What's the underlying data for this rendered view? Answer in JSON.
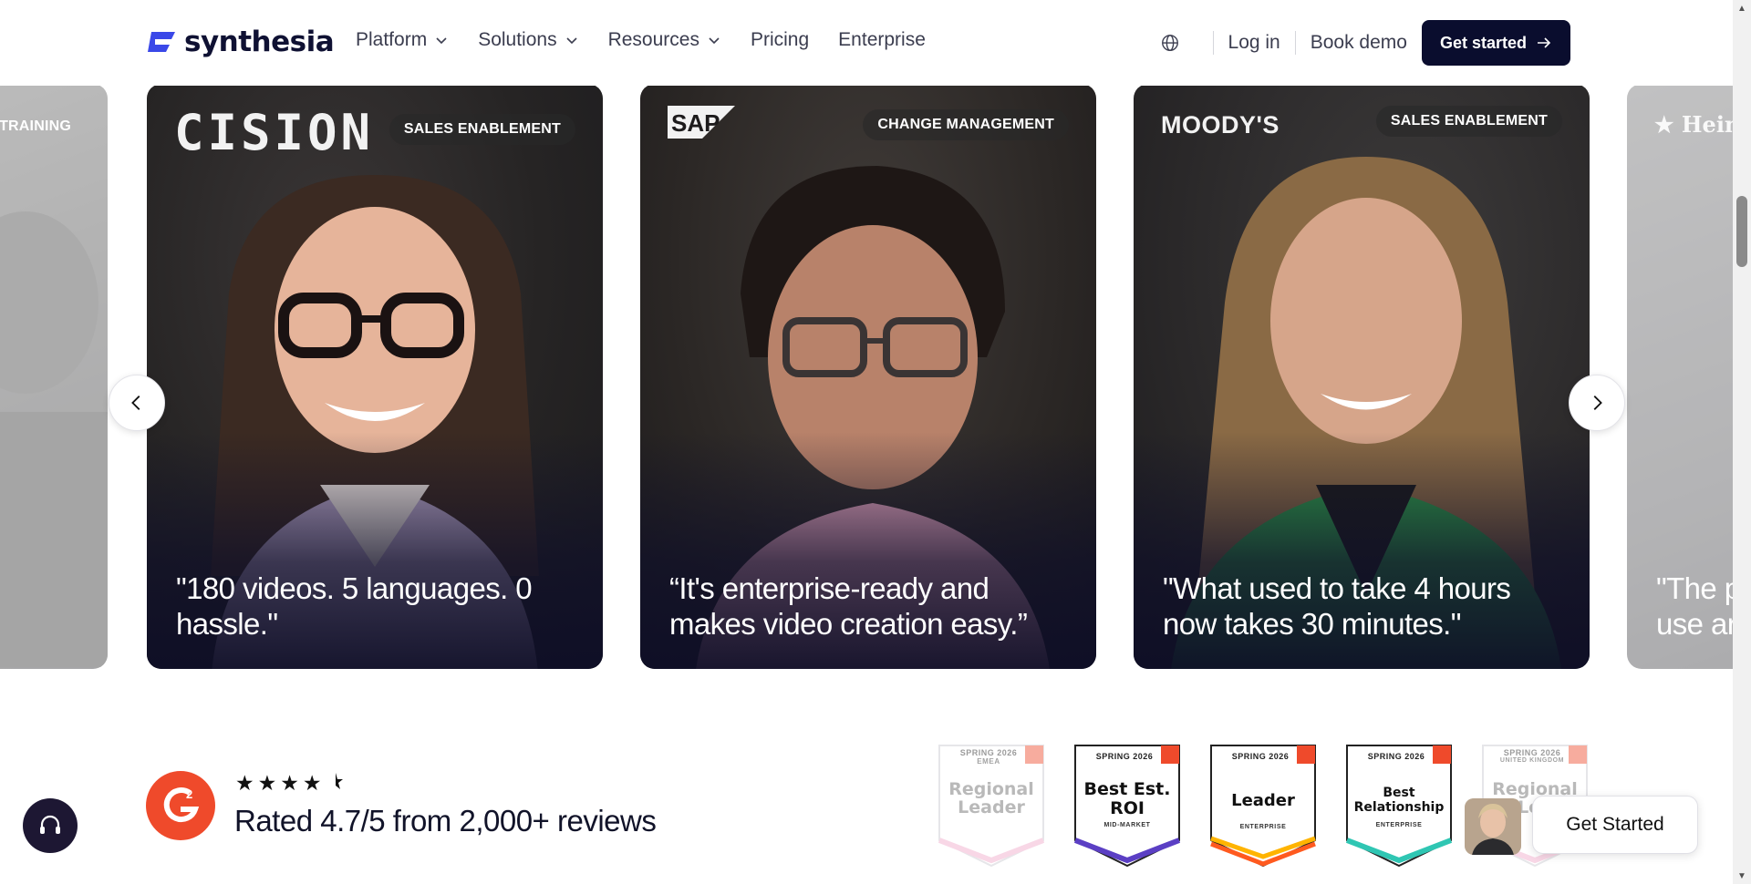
{
  "header": {
    "logo_text": "synthesia",
    "nav": [
      {
        "label": "Platform",
        "has_dropdown": true
      },
      {
        "label": "Solutions",
        "has_dropdown": true
      },
      {
        "label": "Resources",
        "has_dropdown": true
      },
      {
        "label": "Pricing",
        "has_dropdown": false
      },
      {
        "label": "Enterprise",
        "has_dropdown": false
      }
    ],
    "globe_icon": "globe-icon",
    "login": "Log in",
    "book_demo": "Book demo",
    "get_started": "Get started"
  },
  "carousel": {
    "left_partial": {
      "tag": "TRAINING"
    },
    "cards": [
      {
        "brand": "CISION",
        "tag": "SALES ENABLEMENT",
        "quote": "\"180 videos. 5 languages. 0 hassle.\""
      },
      {
        "brand": "SAP",
        "tag": "CHANGE MANAGEMENT",
        "quote": "“It's enterprise-ready and makes video creation easy.”"
      },
      {
        "brand": "MOODY'S",
        "tag": "SALES ENABLEMENT",
        "quote": "\"What used to take 4 hours now takes 30 minutes.\""
      }
    ],
    "right_partial": {
      "brand": "★ Hein",
      "quote": "\"The p use ar"
    },
    "prev_icon": "chevron-left-icon",
    "next_icon": "chevron-right-icon"
  },
  "rating": {
    "stars": "★★★★",
    "rating_value": 4.7,
    "text": "Rated 4.7/5 from 2,000+ reviews",
    "badges": [
      {
        "season": "SPRING 2026",
        "region": "EMEA",
        "title": "Regional Leader",
        "sub": "",
        "color": "#f0a7c8"
      },
      {
        "season": "SPRING 2026",
        "region": "",
        "title": "Best Est. ROI",
        "sub": "MID-MARKET",
        "color": "#5b3fc4"
      },
      {
        "season": "SPRING 2026",
        "region": "",
        "title": "Leader",
        "sub": "ENTERPRISE",
        "color": "#ff5a1f"
      },
      {
        "season": "SPRING 2026",
        "region": "",
        "title": "Best Relationship",
        "sub": "ENTERPRISE",
        "color": "#2fc6b3"
      },
      {
        "season": "SPRING 2026",
        "region": "UNITED KINGDOM",
        "title": "Regional Lea",
        "sub": "",
        "color": "#f0a7c8"
      }
    ]
  },
  "floating": {
    "support_icon": "headset-icon",
    "get_started": "Get Started"
  },
  "colors": {
    "brand_dark": "#0a0d2e",
    "g2_red": "#ef4a2b",
    "logo_blue": "#3a48e8"
  }
}
